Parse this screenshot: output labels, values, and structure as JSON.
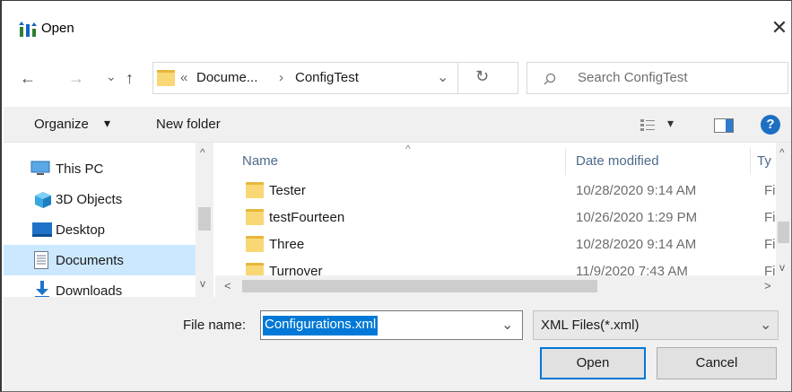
{
  "window": {
    "title": "Open",
    "close_glyph": "✕"
  },
  "nav": {
    "back_glyph": "←",
    "forward_glyph": "→",
    "recent_glyph": "⌄",
    "up_glyph": "↑",
    "breadcrumb_prefix": "«",
    "breadcrumb_parent": "Docume...",
    "breadcrumb_sep": "›",
    "breadcrumb_current": "ConfigTest",
    "dropdown_glyph": "⌄",
    "refresh_glyph": "↻",
    "search_placeholder": "Search ConfigTest"
  },
  "toolbar": {
    "organize_label": "Organize",
    "organize_arrow": "▾",
    "new_folder_label": "New folder",
    "view_arrow": "▾",
    "help_glyph": "?"
  },
  "sidebar": {
    "items": [
      {
        "label": "This PC",
        "icon": "computer-icon",
        "selected": false
      },
      {
        "label": "3D Objects",
        "icon": "cube-icon",
        "selected": false
      },
      {
        "label": "Desktop",
        "icon": "desktop-icon",
        "selected": false
      },
      {
        "label": "Documents",
        "icon": "documents-icon",
        "selected": true
      },
      {
        "label": "Downloads",
        "icon": "download-icon",
        "selected": false
      }
    ]
  },
  "file_list": {
    "columns": {
      "name": "Name",
      "date": "Date modified",
      "type": "Ty"
    },
    "sort_indicator": "^",
    "rows": [
      {
        "name": "Tester",
        "date": "10/28/2020 9:14 AM",
        "type": "Fi"
      },
      {
        "name": "testFourteen",
        "date": "10/26/2020 1:29 PM",
        "type": "Fi"
      },
      {
        "name": "Three",
        "date": "10/28/2020 9:14 AM",
        "type": "Fi"
      },
      {
        "name": "Turnover",
        "date": "11/9/2020 7:43 AM",
        "type": "Fi"
      }
    ]
  },
  "scroll": {
    "up": "^",
    "down": "v",
    "left": "<",
    "right": ">"
  },
  "footer": {
    "file_name_label": "File name:",
    "file_name_value": "Configurations.xml",
    "file_name_dropdown": "⌄",
    "filter_value": "XML Files(*.xml)",
    "filter_dropdown": "⌄",
    "open_label": "Open",
    "cancel_label": "Cancel"
  },
  "colors": {
    "selection": "#0078d7",
    "sidebar_selected": "#cce8ff",
    "folder": "#f8d775",
    "help": "#1e6fc2"
  }
}
